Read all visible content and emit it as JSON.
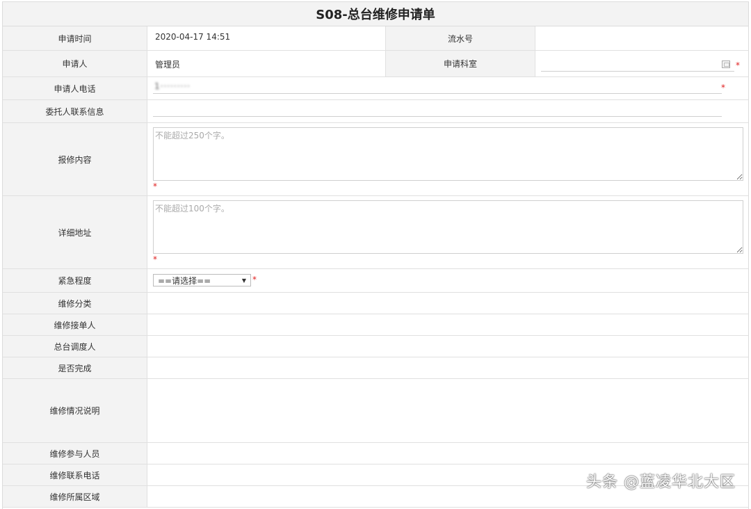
{
  "form": {
    "title": "S08-总台维修申请单",
    "apply_time": {
      "label": "申请时间",
      "value": "2020-04-17 14:51"
    },
    "serial_no": {
      "label": "流水号",
      "value": ""
    },
    "applicant": {
      "label": "申请人",
      "value": "管理员"
    },
    "apply_dept": {
      "label": "申请科室",
      "value": ""
    },
    "applicant_phone": {
      "label": "申请人电话",
      "value": "1·········"
    },
    "delegate_info": {
      "label": "委托人联系信息",
      "value": ""
    },
    "repair_content": {
      "label": "报修内容",
      "placeholder": "不能超过250个字。"
    },
    "address": {
      "label": "详细地址",
      "placeholder": "不能超过100个字。"
    },
    "urgency": {
      "label": "紧急程度",
      "selected": "==请选择=="
    },
    "category": {
      "label": "维修分类"
    },
    "receiver": {
      "label": "维修接单人"
    },
    "dispatcher": {
      "label": "总台调度人"
    },
    "completed": {
      "label": "是否完成"
    },
    "description": {
      "label": "维修情况说明"
    },
    "participants": {
      "label": "维修参与人员"
    },
    "contact_phone": {
      "label": "维修联系电话"
    },
    "area": {
      "label": "维修所属区域"
    },
    "required_mark": "*"
  },
  "watermark": "头条 @蓝凌华北大区",
  "colors": {
    "required": "#e02020",
    "label_bg": "#f3f3f3",
    "border": "#e0e0e0"
  }
}
